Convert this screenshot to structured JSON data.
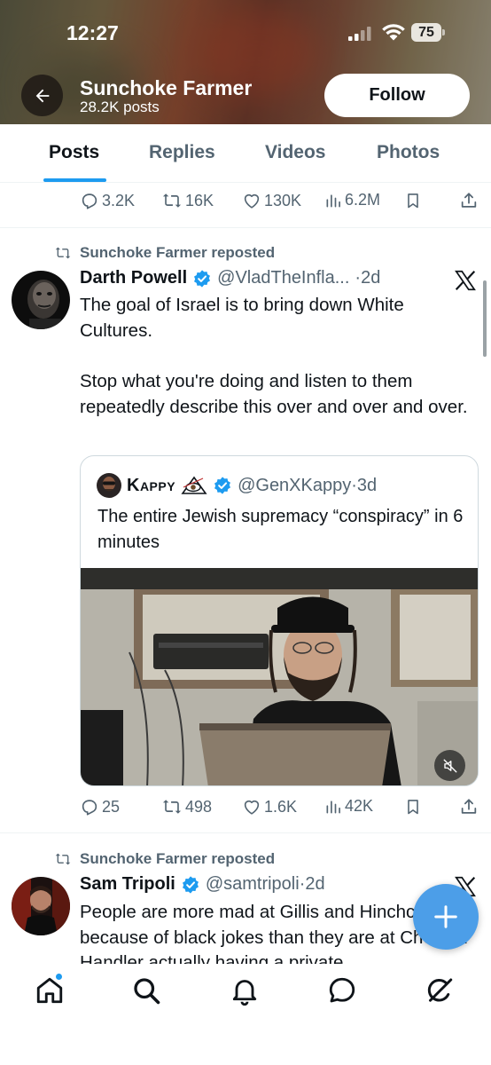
{
  "status_bar": {
    "time": "12:27",
    "battery": "75"
  },
  "header": {
    "name": "Sunchoke Farmer",
    "posts": "28.2K posts",
    "follow_label": "Follow"
  },
  "tabs": [
    {
      "label": "Posts"
    },
    {
      "label": "Replies"
    },
    {
      "label": "Videos"
    },
    {
      "label": "Photos"
    }
  ],
  "top_actions": {
    "replies": "3.2K",
    "reposts": "16K",
    "likes": "130K",
    "views": "6.2M"
  },
  "tweets": [
    {
      "repost_label": "Sunchoke Farmer reposted",
      "display_name": "Darth Powell",
      "handle": "@VladTheInfla...",
      "time": "·2d",
      "text_line1": "The goal of Israel is to bring down White Cultures.",
      "text_line2": "Stop what you're doing and listen to them repeatedly describe this over and over and over.",
      "quote": {
        "display_name": "Kappy",
        "handle": "@GenXKappy",
        "time": "·3d",
        "text": "The entire Jewish supremacy “conspiracy” in 6 minutes"
      },
      "actions": {
        "replies": "25",
        "reposts": "498",
        "likes": "1.6K",
        "views": "42K"
      }
    },
    {
      "repost_label": "Sunchoke Farmer reposted",
      "display_name": "Sam Tripoli",
      "handle": "@samtripoli",
      "time": "·2d",
      "text": "People are more mad at Gillis and Hinchcliffe because of black jokes than they are at Chelsea Handler actually having a private"
    }
  ],
  "colors": {
    "accent": "#1d9bf0",
    "verified": "#1d9bf0",
    "secondary_text": "#536471",
    "fab": "#4c9ee8"
  },
  "icons": [
    "back-arrow-icon",
    "verified-badge-icon",
    "x-logo-icon",
    "reply-icon",
    "repost-icon",
    "like-icon",
    "views-icon",
    "bookmark-icon",
    "share-icon",
    "mute-icon",
    "compose-plus-icon",
    "home-icon",
    "search-icon",
    "bell-icon",
    "messages-icon",
    "grok-icon"
  ]
}
